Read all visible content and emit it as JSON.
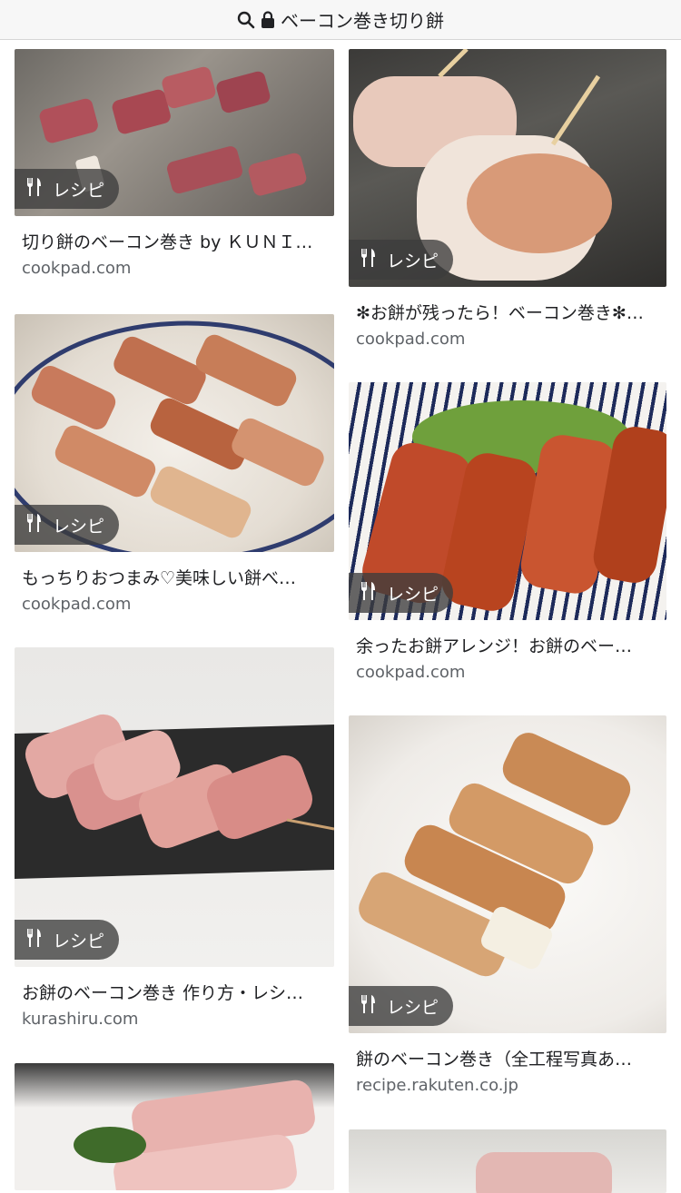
{
  "search": {
    "query": "ベーコン巻き切り餅"
  },
  "badge_label": "レシピ",
  "icons": {
    "search": "search-icon",
    "lock": "lock-icon",
    "recipe": "fork-knife-icon"
  },
  "results_left": [
    {
      "title": "切り餅のベーコン巻き by ＫＵＮＩ…",
      "source": "cookpad.com"
    },
    {
      "title": "もっちりおつまみ♡美味しい餅べ…",
      "source": "cookpad.com"
    },
    {
      "title": "お餅のベーコン巻き 作り方・レシ…",
      "source": "kurashiru.com"
    },
    {
      "title": "",
      "source": ""
    }
  ],
  "results_right": [
    {
      "title": "✻お餅が残ったら！ベーコン巻き✻…",
      "source": "cookpad.com"
    },
    {
      "title": "余ったお餅アレンジ！お餅のベー…",
      "source": "cookpad.com"
    },
    {
      "title": "餅のベーコン巻き（全工程写真あ…",
      "source": "recipe.rakuten.co.jp"
    },
    {
      "title": "",
      "source": ""
    }
  ]
}
